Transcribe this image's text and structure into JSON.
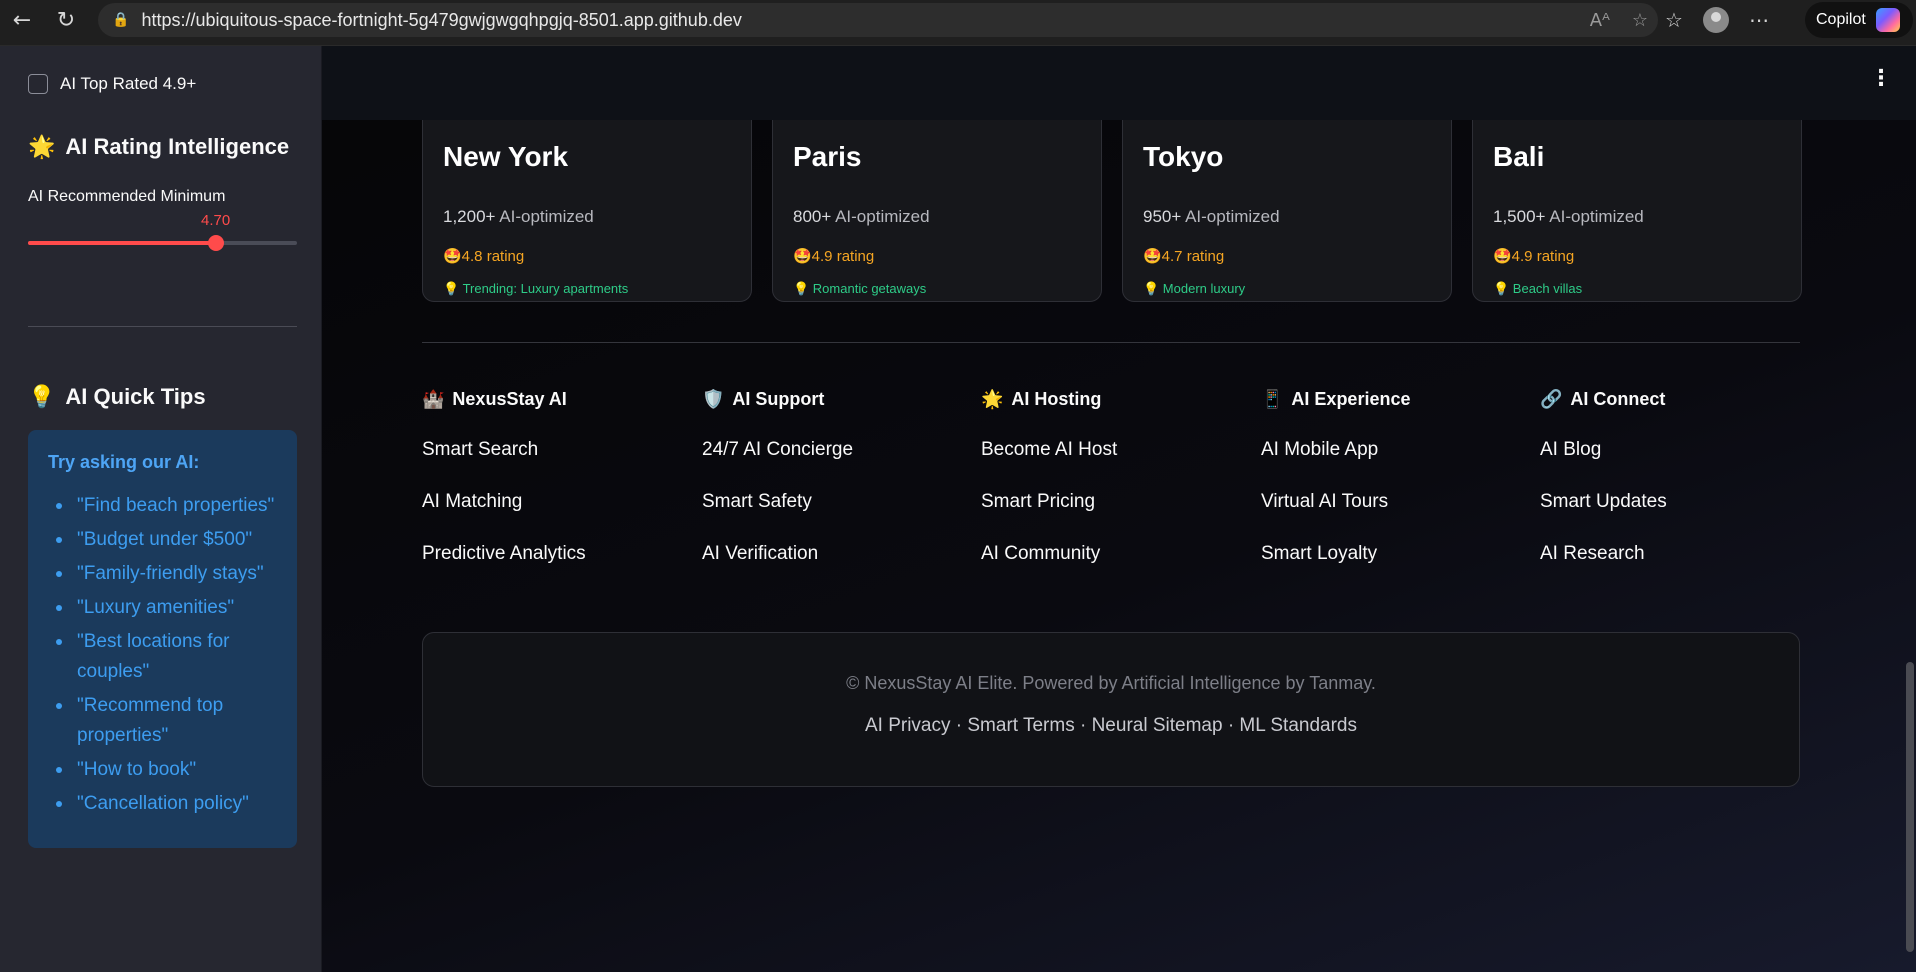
{
  "browser": {
    "url": "https://ubiquitous-space-fortnight-5g479gwjgwgqhpgjq-8501.app.github.dev",
    "copilot_label": "Copilot"
  },
  "sidebar": {
    "top_rated_label": "AI Top Rated 4.9+",
    "top_rated_checked": false,
    "rating_heading": "AI Rating Intelligence",
    "rating_icon": "🌟",
    "slider_label": "AI Recommended Minimum",
    "slider_value": "4.70",
    "slider_fraction": 0.7,
    "tips_heading": "AI Quick Tips",
    "tips_icon": "💡",
    "tips_box_title": "Try asking our AI:",
    "tips": [
      "\"Find beach properties\"",
      "\"Budget under $500\"",
      "\"Family-friendly stays\"",
      "\"Luxury amenities\"",
      "\"Best locations for couples\"",
      "\"Recommend top properties\"",
      "\"How to book\"",
      "\"Cancellation policy\""
    ]
  },
  "cards": [
    {
      "city": "New York",
      "count_strong": "1,200+",
      "count_rest": " AI-optimized",
      "rating": "🤩4.8 rating",
      "tip": "💡 Trending: Luxury apartments"
    },
    {
      "city": "Paris",
      "count_strong": "800+",
      "count_rest": " AI-optimized",
      "rating": "🤩4.9 rating",
      "tip": "💡 Romantic getaways"
    },
    {
      "city": "Tokyo",
      "count_strong": "950+",
      "count_rest": " AI-optimized",
      "rating": "🤩4.7 rating",
      "tip": "💡 Modern luxury"
    },
    {
      "city": "Bali",
      "count_strong": "1,500+",
      "count_rest": " AI-optimized",
      "rating": "🤩4.9 rating",
      "tip": "💡 Beach villas"
    }
  ],
  "footer": {
    "columns": [
      {
        "icon": "🏰",
        "title": "NexusStay AI",
        "links": [
          "Smart Search",
          "AI Matching",
          "Predictive Analytics"
        ]
      },
      {
        "icon": "🛡️",
        "title": "AI Support",
        "links": [
          "24/7 AI Concierge",
          "Smart Safety",
          "AI Verification"
        ]
      },
      {
        "icon": "🌟",
        "title": "AI Hosting",
        "links": [
          "Become AI Host",
          "Smart Pricing",
          "AI Community"
        ]
      },
      {
        "icon": "📱",
        "title": "AI Experience",
        "links": [
          "AI Mobile App",
          "Virtual AI Tours",
          "Smart Loyalty"
        ]
      },
      {
        "icon": "🔗",
        "title": "AI Connect",
        "links": [
          "AI Blog",
          "Smart Updates",
          "AI Research"
        ]
      }
    ],
    "copyright": "© NexusStay AI Elite. Powered by Artificial Intelligence by Tanmay.",
    "legal": "AI Privacy · Smart Terms · Neural Sitemap · ML Standards"
  }
}
